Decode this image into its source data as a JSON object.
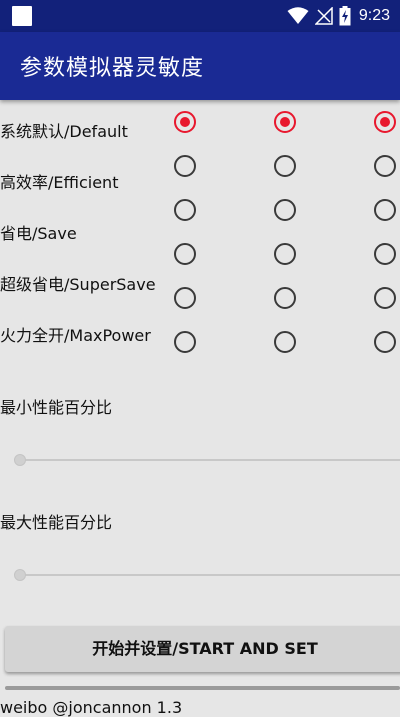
{
  "status_bar": {
    "time": "9:23",
    "icons": [
      "notification-square-icon",
      "wifi-icon",
      "signal-off-icon",
      "battery-charging-icon"
    ]
  },
  "app_bar": {
    "title": "参数模拟器灵敏度"
  },
  "modes": [
    {
      "label": "系统默认/Default",
      "selected": [
        true,
        true,
        true
      ]
    },
    {
      "label": "高效率/Efficient",
      "selected": [
        false,
        false,
        false
      ]
    },
    {
      "label": "省电/Save",
      "selected": [
        false,
        false,
        false
      ]
    },
    {
      "label": "超级省电/SuperSave",
      "selected": [
        false,
        false,
        false
      ]
    },
    {
      "label": "火力全开/MaxPower",
      "selected": [
        false,
        false,
        false
      ]
    }
  ],
  "extra_radio_row": {
    "selected": [
      false,
      false,
      false
    ]
  },
  "min_perf": {
    "label": "最小性能百分比",
    "value": 0
  },
  "max_perf": {
    "label": "最大性能百分比",
    "value": 0
  },
  "start_button": {
    "label": "开始并设置/START AND SET"
  },
  "footer": {
    "text": "weibo @joncannon 1.3"
  },
  "colors": {
    "appbar": "#1a2a94",
    "statusbar": "#12217a",
    "radio_checked": "#e8182e"
  }
}
